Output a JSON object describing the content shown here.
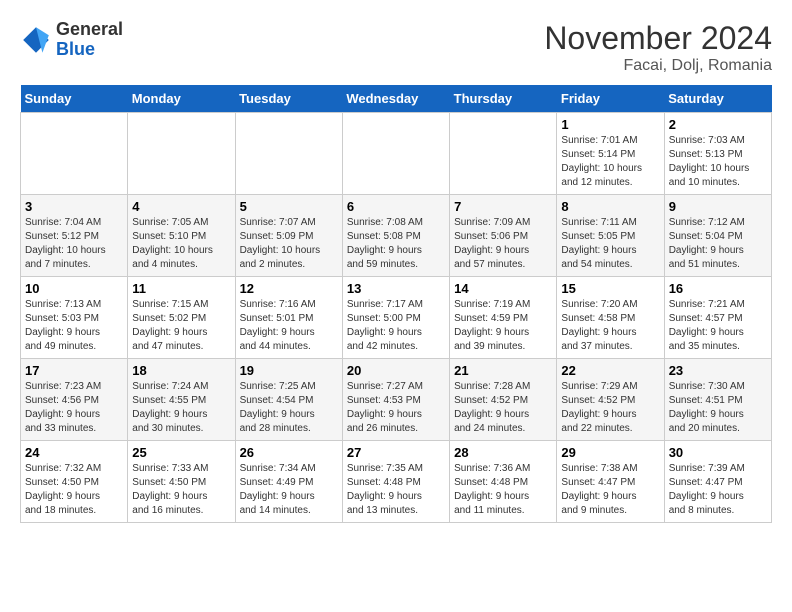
{
  "header": {
    "logo_general": "General",
    "logo_blue": "Blue",
    "month_title": "November 2024",
    "location": "Facai, Dolj, Romania"
  },
  "weekdays": [
    "Sunday",
    "Monday",
    "Tuesday",
    "Wednesday",
    "Thursday",
    "Friday",
    "Saturday"
  ],
  "weeks": [
    [
      {
        "day": "",
        "info": ""
      },
      {
        "day": "",
        "info": ""
      },
      {
        "day": "",
        "info": ""
      },
      {
        "day": "",
        "info": ""
      },
      {
        "day": "",
        "info": ""
      },
      {
        "day": "1",
        "info": "Sunrise: 7:01 AM\nSunset: 5:14 PM\nDaylight: 10 hours\nand 12 minutes."
      },
      {
        "day": "2",
        "info": "Sunrise: 7:03 AM\nSunset: 5:13 PM\nDaylight: 10 hours\nand 10 minutes."
      }
    ],
    [
      {
        "day": "3",
        "info": "Sunrise: 7:04 AM\nSunset: 5:12 PM\nDaylight: 10 hours\nand 7 minutes."
      },
      {
        "day": "4",
        "info": "Sunrise: 7:05 AM\nSunset: 5:10 PM\nDaylight: 10 hours\nand 4 minutes."
      },
      {
        "day": "5",
        "info": "Sunrise: 7:07 AM\nSunset: 5:09 PM\nDaylight: 10 hours\nand 2 minutes."
      },
      {
        "day": "6",
        "info": "Sunrise: 7:08 AM\nSunset: 5:08 PM\nDaylight: 9 hours\nand 59 minutes."
      },
      {
        "day": "7",
        "info": "Sunrise: 7:09 AM\nSunset: 5:06 PM\nDaylight: 9 hours\nand 57 minutes."
      },
      {
        "day": "8",
        "info": "Sunrise: 7:11 AM\nSunset: 5:05 PM\nDaylight: 9 hours\nand 54 minutes."
      },
      {
        "day": "9",
        "info": "Sunrise: 7:12 AM\nSunset: 5:04 PM\nDaylight: 9 hours\nand 51 minutes."
      }
    ],
    [
      {
        "day": "10",
        "info": "Sunrise: 7:13 AM\nSunset: 5:03 PM\nDaylight: 9 hours\nand 49 minutes."
      },
      {
        "day": "11",
        "info": "Sunrise: 7:15 AM\nSunset: 5:02 PM\nDaylight: 9 hours\nand 47 minutes."
      },
      {
        "day": "12",
        "info": "Sunrise: 7:16 AM\nSunset: 5:01 PM\nDaylight: 9 hours\nand 44 minutes."
      },
      {
        "day": "13",
        "info": "Sunrise: 7:17 AM\nSunset: 5:00 PM\nDaylight: 9 hours\nand 42 minutes."
      },
      {
        "day": "14",
        "info": "Sunrise: 7:19 AM\nSunset: 4:59 PM\nDaylight: 9 hours\nand 39 minutes."
      },
      {
        "day": "15",
        "info": "Sunrise: 7:20 AM\nSunset: 4:58 PM\nDaylight: 9 hours\nand 37 minutes."
      },
      {
        "day": "16",
        "info": "Sunrise: 7:21 AM\nSunset: 4:57 PM\nDaylight: 9 hours\nand 35 minutes."
      }
    ],
    [
      {
        "day": "17",
        "info": "Sunrise: 7:23 AM\nSunset: 4:56 PM\nDaylight: 9 hours\nand 33 minutes."
      },
      {
        "day": "18",
        "info": "Sunrise: 7:24 AM\nSunset: 4:55 PM\nDaylight: 9 hours\nand 30 minutes."
      },
      {
        "day": "19",
        "info": "Sunrise: 7:25 AM\nSunset: 4:54 PM\nDaylight: 9 hours\nand 28 minutes."
      },
      {
        "day": "20",
        "info": "Sunrise: 7:27 AM\nSunset: 4:53 PM\nDaylight: 9 hours\nand 26 minutes."
      },
      {
        "day": "21",
        "info": "Sunrise: 7:28 AM\nSunset: 4:52 PM\nDaylight: 9 hours\nand 24 minutes."
      },
      {
        "day": "22",
        "info": "Sunrise: 7:29 AM\nSunset: 4:52 PM\nDaylight: 9 hours\nand 22 minutes."
      },
      {
        "day": "23",
        "info": "Sunrise: 7:30 AM\nSunset: 4:51 PM\nDaylight: 9 hours\nand 20 minutes."
      }
    ],
    [
      {
        "day": "24",
        "info": "Sunrise: 7:32 AM\nSunset: 4:50 PM\nDaylight: 9 hours\nand 18 minutes."
      },
      {
        "day": "25",
        "info": "Sunrise: 7:33 AM\nSunset: 4:50 PM\nDaylight: 9 hours\nand 16 minutes."
      },
      {
        "day": "26",
        "info": "Sunrise: 7:34 AM\nSunset: 4:49 PM\nDaylight: 9 hours\nand 14 minutes."
      },
      {
        "day": "27",
        "info": "Sunrise: 7:35 AM\nSunset: 4:48 PM\nDaylight: 9 hours\nand 13 minutes."
      },
      {
        "day": "28",
        "info": "Sunrise: 7:36 AM\nSunset: 4:48 PM\nDaylight: 9 hours\nand 11 minutes."
      },
      {
        "day": "29",
        "info": "Sunrise: 7:38 AM\nSunset: 4:47 PM\nDaylight: 9 hours\nand 9 minutes."
      },
      {
        "day": "30",
        "info": "Sunrise: 7:39 AM\nSunset: 4:47 PM\nDaylight: 9 hours\nand 8 minutes."
      }
    ]
  ]
}
